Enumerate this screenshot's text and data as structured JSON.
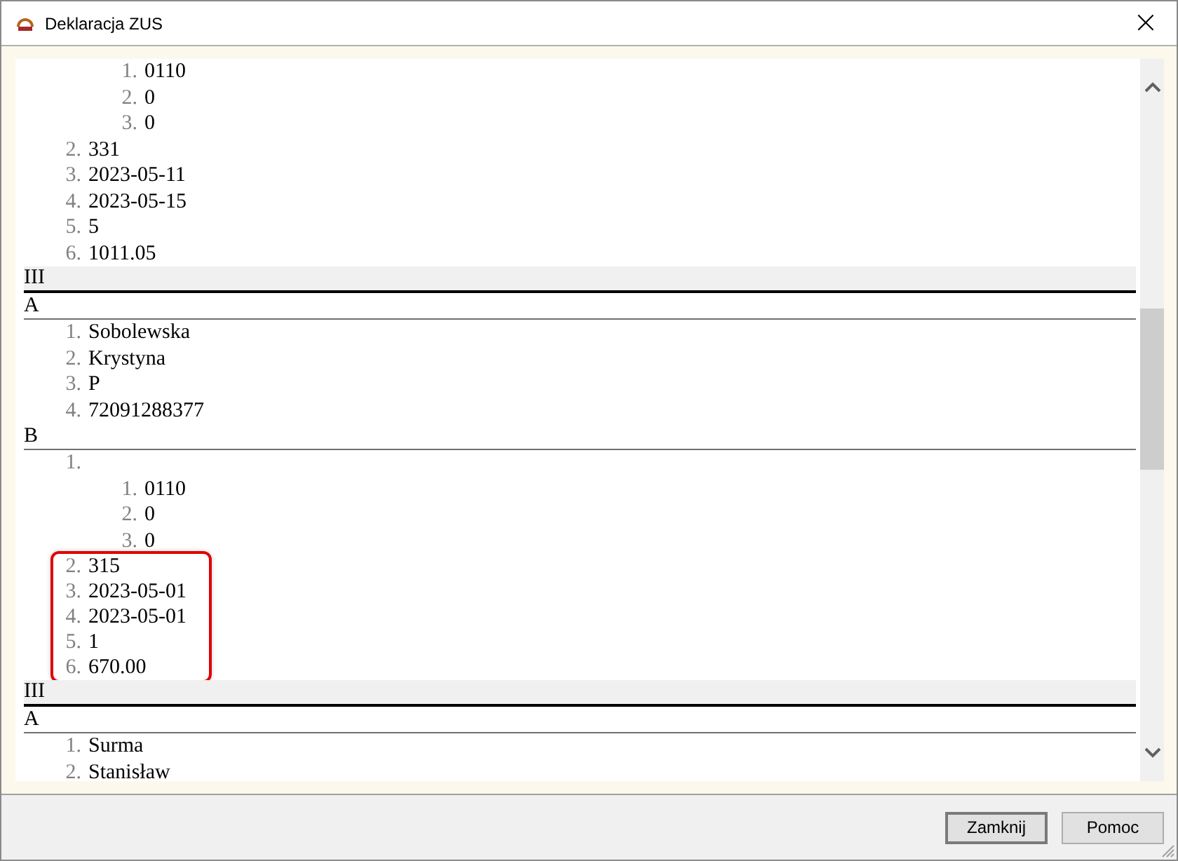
{
  "window": {
    "title": "Deklaracja ZUS",
    "close": "×"
  },
  "document": [
    {
      "kind": "list",
      "groups": [
        {
          "highlighted": false,
          "items": [
            {
              "children": [
                {
                  "num": "1.",
                  "value": "0110"
                },
                {
                  "num": "2.",
                  "value": "0"
                },
                {
                  "num": "3.",
                  "value": "0"
                }
              ]
            },
            {
              "num": "2.",
              "value": "331"
            },
            {
              "num": "3.",
              "value": "2023-05-11"
            },
            {
              "num": "4.",
              "value": "2023-05-15"
            },
            {
              "num": "5.",
              "value": "5"
            },
            {
              "num": "6.",
              "value": "1011.05"
            }
          ]
        }
      ]
    },
    {
      "kind": "section",
      "label": "III"
    },
    {
      "kind": "subsection",
      "label": "A"
    },
    {
      "kind": "list",
      "groups": [
        {
          "highlighted": false,
          "items": [
            {
              "num": "1.",
              "value": "Sobolewska"
            },
            {
              "num": "2.",
              "value": "Krystyna"
            },
            {
              "num": "3.",
              "value": "P"
            },
            {
              "num": "4.",
              "value": "72091288377"
            }
          ]
        }
      ]
    },
    {
      "kind": "subsection",
      "label": "B"
    },
    {
      "kind": "list",
      "groups": [
        {
          "highlighted": false,
          "items": [
            {
              "num": "1.",
              "children": [
                {
                  "num": "1.",
                  "value": "0110"
                },
                {
                  "num": "2.",
                  "value": "0"
                },
                {
                  "num": "3.",
                  "value": "0"
                }
              ]
            }
          ]
        },
        {
          "highlighted": true,
          "items": [
            {
              "num": "2.",
              "value": "315"
            },
            {
              "num": "3.",
              "value": "2023-05-01"
            },
            {
              "num": "4.",
              "value": "2023-05-01"
            },
            {
              "num": "5.",
              "value": "1"
            },
            {
              "num": "6.",
              "value": "670.00"
            }
          ]
        }
      ]
    },
    {
      "kind": "section",
      "label": "III"
    },
    {
      "kind": "subsection",
      "label": "A"
    },
    {
      "kind": "list",
      "groups": [
        {
          "highlighted": false,
          "items": [
            {
              "num": "1.",
              "value": "Surma"
            },
            {
              "num": "2.",
              "value": "Stanisław"
            }
          ]
        }
      ]
    }
  ],
  "buttons": [
    "Zamknij",
    "Pomoc"
  ]
}
